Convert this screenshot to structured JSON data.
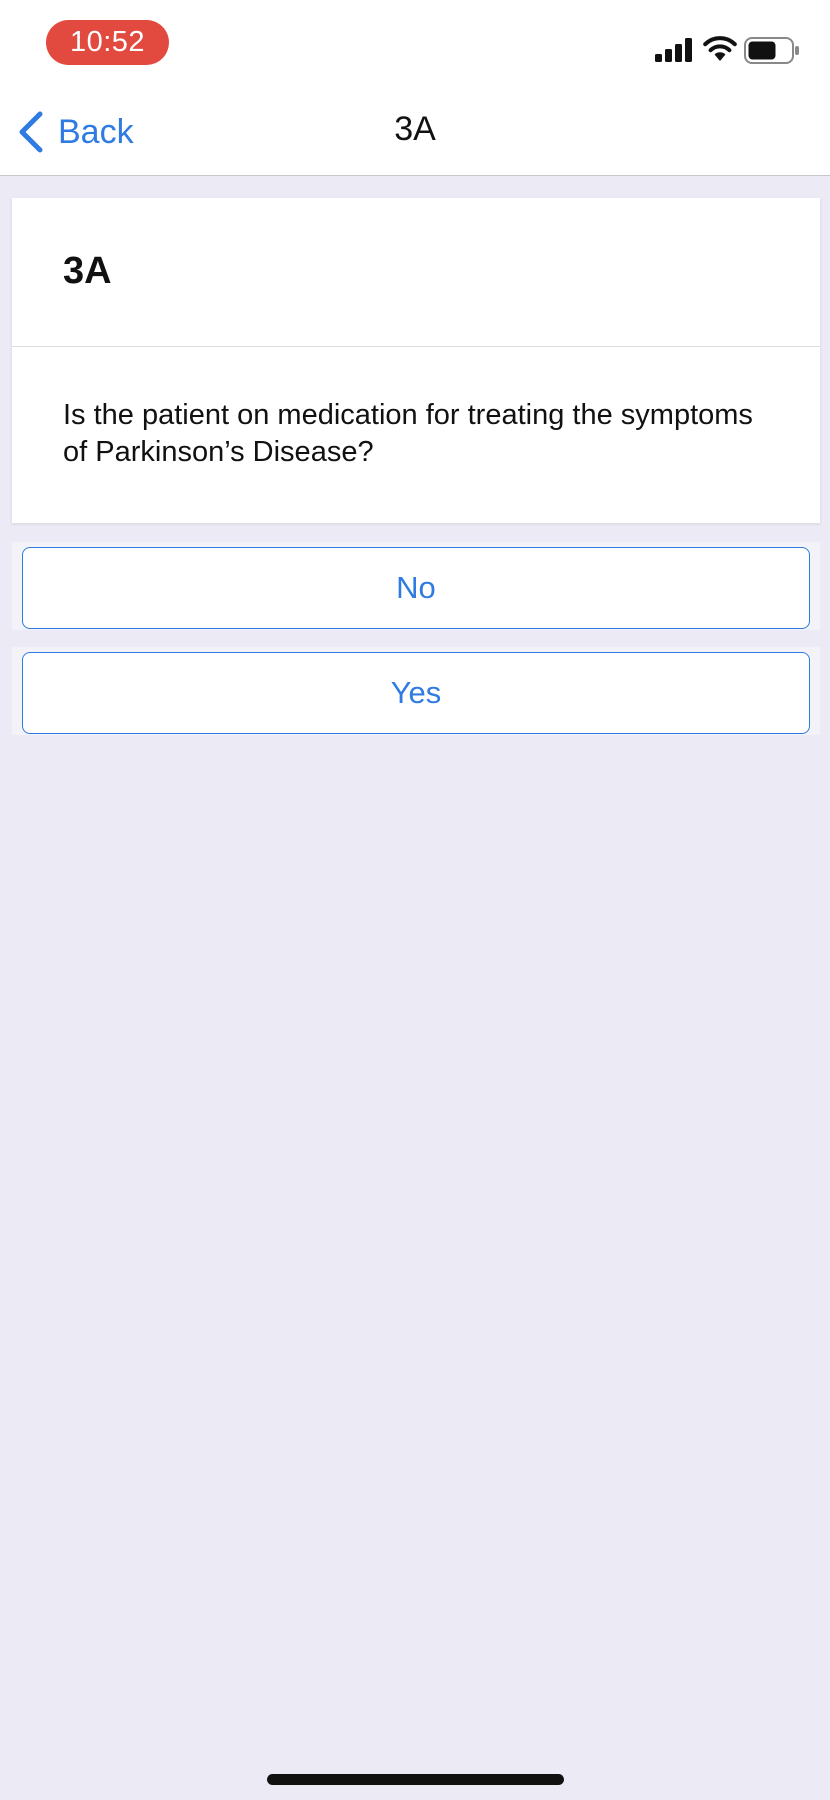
{
  "status_bar": {
    "time": "10:52",
    "time_pill_color": "#E24A3F",
    "signal_icon": "cellular-signal-icon",
    "wifi_icon": "wifi-icon",
    "battery_icon": "battery-icon"
  },
  "nav": {
    "back_label": "Back",
    "title": "3A"
  },
  "card": {
    "title": "3A",
    "question": "Is the patient on medication for treating the symptoms of Parkinson’s Disease?"
  },
  "options": [
    {
      "label": "No"
    },
    {
      "label": "Yes"
    }
  ],
  "colors": {
    "accent": "#2F7BE2",
    "background": "#ECEAF4"
  }
}
